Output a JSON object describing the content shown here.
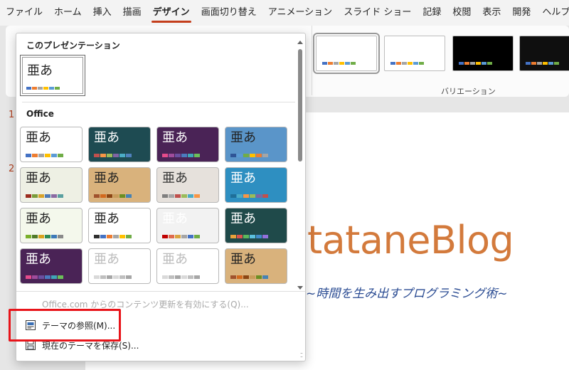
{
  "ribbon_tabs": [
    "ファイル",
    "ホーム",
    "挿入",
    "描画",
    "デザイン",
    "画面切り替え",
    "アニメーション",
    "スライド ショー",
    "記録",
    "校閲",
    "表示",
    "開発",
    "ヘルプ"
  ],
  "active_tab": "デザイン",
  "variations": {
    "label": "バリエーション",
    "thumbs": [
      {
        "bg": "#ffffff",
        "colors": [
          "#4472c4",
          "#ed7d31",
          "#a5a5a5",
          "#ffc000",
          "#5b9bd5",
          "#70ad47"
        ]
      },
      {
        "bg": "#ffffff",
        "colors": [
          "#4472c4",
          "#ed7d31",
          "#a5a5a5",
          "#ffc000",
          "#5b9bd5",
          "#70ad47"
        ]
      },
      {
        "bg": "#000000",
        "colors": [
          "#4472c4",
          "#ed7d31",
          "#a5a5a5",
          "#ffc000",
          "#5b9bd5",
          "#70ad47"
        ]
      },
      {
        "bg": "#0f0f0f",
        "colors": [
          "#4472c4",
          "#ed7d31",
          "#a5a5a5",
          "#ffc000",
          "#5b9bd5",
          "#70ad47"
        ]
      }
    ]
  },
  "panel": {
    "this_presentation_title": "このプレゼンテーション",
    "current_theme_sample": "亜あ",
    "office_title": "Office",
    "themes": [
      {
        "sample": "亜あ",
        "bg": "#ffffff",
        "text": "#222222",
        "colors": [
          "#4472c4",
          "#ed7d31",
          "#a5a5a5",
          "#ffc000",
          "#5b9bd5",
          "#70ad47"
        ]
      },
      {
        "sample": "亜あ",
        "bg": "#1e4b52",
        "text": "#ffffff",
        "colors": [
          "#c0504d",
          "#f79646",
          "#9bbb59",
          "#8064a2",
          "#4bacc6",
          "#4f81bd"
        ]
      },
      {
        "sample": "亜あ",
        "bg": "#4a2356",
        "text": "#ffffff",
        "colors": [
          "#e54b8b",
          "#a04c9c",
          "#6b4fa0",
          "#4b7bbf",
          "#3fa7b7",
          "#6bbf59"
        ]
      },
      {
        "sample": "亜あ",
        "bg": "#5a95c9",
        "text": "#222222",
        "colors": [
          "#2f5597",
          "#5b9bd5",
          "#70ad47",
          "#ffc000",
          "#ed7d31",
          "#a5a5a5"
        ]
      },
      {
        "sample": "亜あ",
        "bg": "#eef0e4",
        "text": "#222222",
        "colors": [
          "#9b2d1f",
          "#7a9c3a",
          "#d8a32a",
          "#4e7ab5",
          "#8a6aa3",
          "#5aa0a0"
        ]
      },
      {
        "sample": "亜あ",
        "bg": "#d9b27c",
        "text": "#222222",
        "colors": [
          "#a0522d",
          "#d2691e",
          "#8b4513",
          "#c89b5a",
          "#6b8e23",
          "#4682b4"
        ]
      },
      {
        "sample": "亜あ",
        "bg": "#e6e1dc",
        "text": "#333333",
        "colors": [
          "#7f7f7f",
          "#a5a5a5",
          "#c0504d",
          "#9bbb59",
          "#4bacc6",
          "#f79646"
        ]
      },
      {
        "sample": "亜あ",
        "bg": "#2e8fc1",
        "text": "#ffffff",
        "colors": [
          "#1f6f99",
          "#4bacc6",
          "#f79646",
          "#9bbb59",
          "#8064a2",
          "#c0504d"
        ]
      },
      {
        "sample": "亜あ",
        "bg": "#f4f8ec",
        "text": "#222222",
        "colors": [
          "#7ab02c",
          "#4f7a28",
          "#d9a31e",
          "#2e8b57",
          "#3d7ab8",
          "#8a8a8a"
        ]
      },
      {
        "sample": "亜あ",
        "bg": "#ffffff",
        "text": "#222222",
        "colors": [
          "#2f2f2f",
          "#4472c4",
          "#ed7d31",
          "#a5a5a5",
          "#ffc000",
          "#70ad47"
        ]
      },
      {
        "sample": "亜あ",
        "bg": "#f2f2f2",
        "text": "#ffffff",
        "colors": [
          "#c00000",
          "#e06b4c",
          "#d9a441",
          "#a5a5a5",
          "#4472c4",
          "#70ad47"
        ]
      },
      {
        "sample": "亜あ",
        "bg": "#1f4a4a",
        "text": "#ffffff",
        "colors": [
          "#e9a23b",
          "#d9534f",
          "#5cb85c",
          "#5bc0de",
          "#428bca",
          "#9370db"
        ]
      },
      {
        "sample": "亜あ",
        "bg": "#4a2356",
        "text": "#ffffff",
        "colors": [
          "#e54b8b",
          "#a04c9c",
          "#6b4fa0",
          "#4b7bbf",
          "#3fa7b7",
          "#6bbf59"
        ]
      },
      {
        "sample": "亜あ",
        "bg": "#ffffff",
        "text": "#bbbbbb",
        "colors": [
          "#d9d9d9",
          "#bfbfbf",
          "#a6a6a6",
          "#d9d9d9",
          "#bfbfbf",
          "#a6a6a6"
        ]
      },
      {
        "sample": "亜あ",
        "bg": "#ffffff",
        "text": "#bbbbbb",
        "colors": [
          "#d9d9d9",
          "#bfbfbf",
          "#a6a6a6",
          "#d9d9d9",
          "#bfbfbf",
          "#a6a6a6"
        ]
      },
      {
        "sample": "亜あ",
        "bg": "#d9b27c",
        "text": "#222222",
        "colors": [
          "#a0522d",
          "#d2691e",
          "#8b4513",
          "#c89b5a",
          "#6b8e23",
          "#4682b4"
        ]
      }
    ],
    "menu": {
      "enable_updates": "Office.com からのコンテンツ更新を有効にする(Q)...",
      "browse_themes": "テーマの参照(M)...",
      "save_theme": "現在のテーマを保存(S)..."
    }
  },
  "slide": {
    "title": "tataneBlog",
    "subtitle": "~時間を生み出すプログラミング術~",
    "slide_numbers": [
      "1",
      "2"
    ]
  }
}
